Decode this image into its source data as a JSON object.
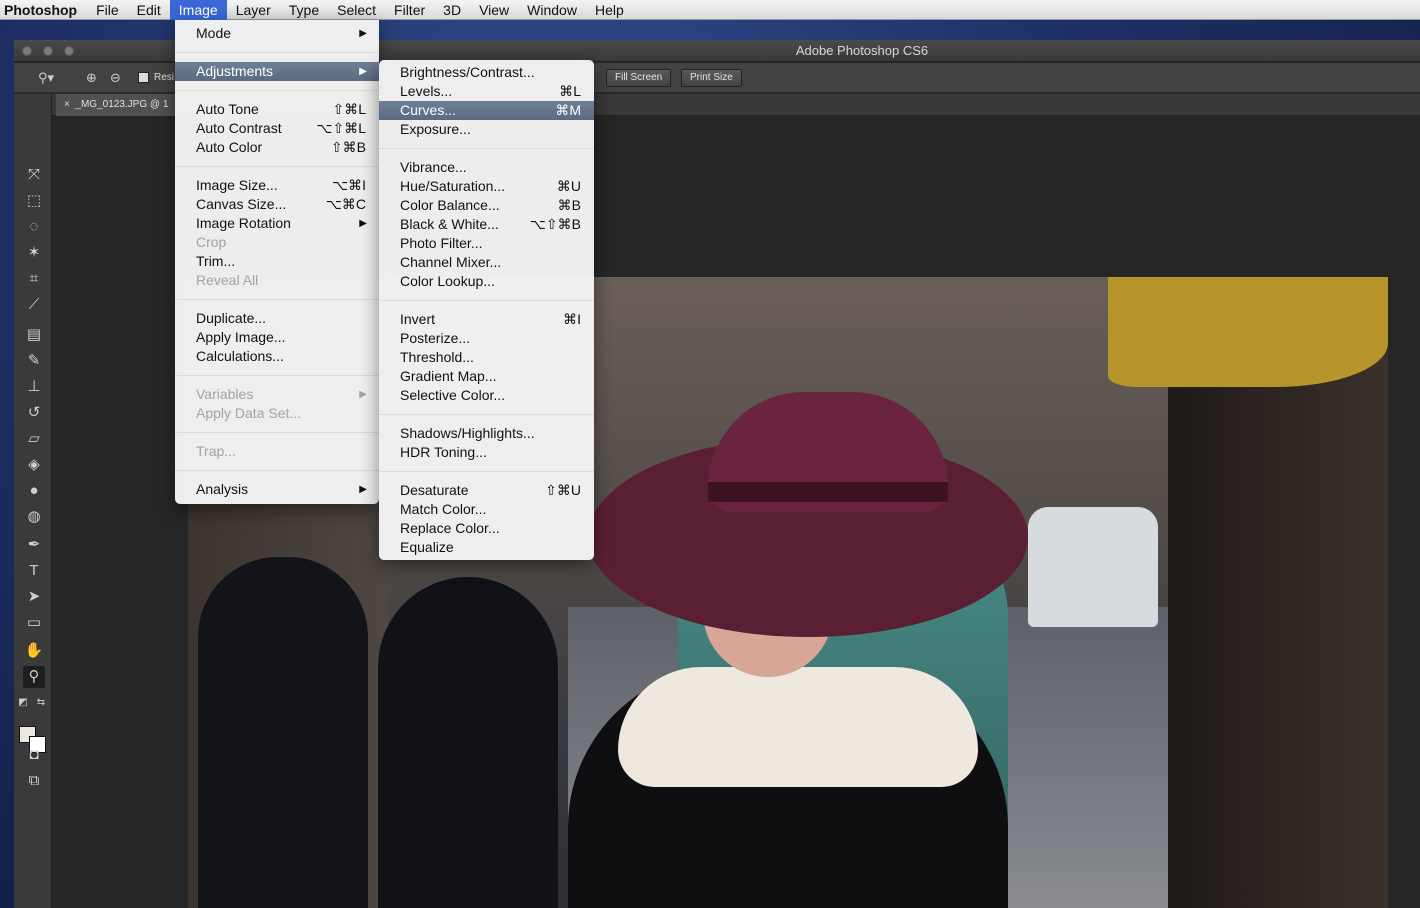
{
  "menubar": {
    "app": "Photoshop",
    "items": [
      "File",
      "Edit",
      "Image",
      "Layer",
      "Type",
      "Select",
      "Filter",
      "3D",
      "View",
      "Window",
      "Help"
    ],
    "active_index": 2
  },
  "window": {
    "title": "Adobe Photoshop CS6"
  },
  "options_bar": {
    "resize_label": "Resi",
    "fill_screen": "Fill Screen",
    "print_size": "Print Size"
  },
  "document_tab": {
    "title": "_MG_0123.JPG @ 1",
    "close": "×"
  },
  "image_menu": {
    "mode": "Mode",
    "adjustments": "Adjustments",
    "auto_tone": "Auto Tone",
    "auto_tone_sc": "⇧⌘L",
    "auto_contrast": "Auto Contrast",
    "auto_contrast_sc": "⌥⇧⌘L",
    "auto_color": "Auto Color",
    "auto_color_sc": "⇧⌘B",
    "image_size": "Image Size...",
    "image_size_sc": "⌥⌘I",
    "canvas_size": "Canvas Size...",
    "canvas_size_sc": "⌥⌘C",
    "image_rotation": "Image Rotation",
    "crop": "Crop",
    "trim": "Trim...",
    "reveal_all": "Reveal All",
    "duplicate": "Duplicate...",
    "apply_image": "Apply Image...",
    "calculations": "Calculations...",
    "variables": "Variables",
    "apply_data_set": "Apply Data Set...",
    "trap": "Trap...",
    "analysis": "Analysis"
  },
  "adjustments_menu": {
    "brightness_contrast": "Brightness/Contrast...",
    "levels": "Levels...",
    "levels_sc": "⌘L",
    "curves": "Curves...",
    "curves_sc": "⌘M",
    "exposure": "Exposure...",
    "vibrance": "Vibrance...",
    "hue_saturation": "Hue/Saturation...",
    "hue_saturation_sc": "⌘U",
    "color_balance": "Color Balance...",
    "color_balance_sc": "⌘B",
    "black_white": "Black & White...",
    "black_white_sc": "⌥⇧⌘B",
    "photo_filter": "Photo Filter...",
    "channel_mixer": "Channel Mixer...",
    "color_lookup": "Color Lookup...",
    "invert": "Invert",
    "invert_sc": "⌘I",
    "posterize": "Posterize...",
    "threshold": "Threshold...",
    "gradient_map": "Gradient Map...",
    "selective_color": "Selective Color...",
    "shadows_highlights": "Shadows/Highlights...",
    "hdr_toning": "HDR Toning...",
    "desaturate": "Desaturate",
    "desaturate_sc": "⇧⌘U",
    "match_color": "Match Color...",
    "replace_color": "Replace Color...",
    "equalize": "Equalize"
  },
  "colors": {
    "menu_highlight": "#5f6f86",
    "menubar_active": "#3968d6"
  }
}
